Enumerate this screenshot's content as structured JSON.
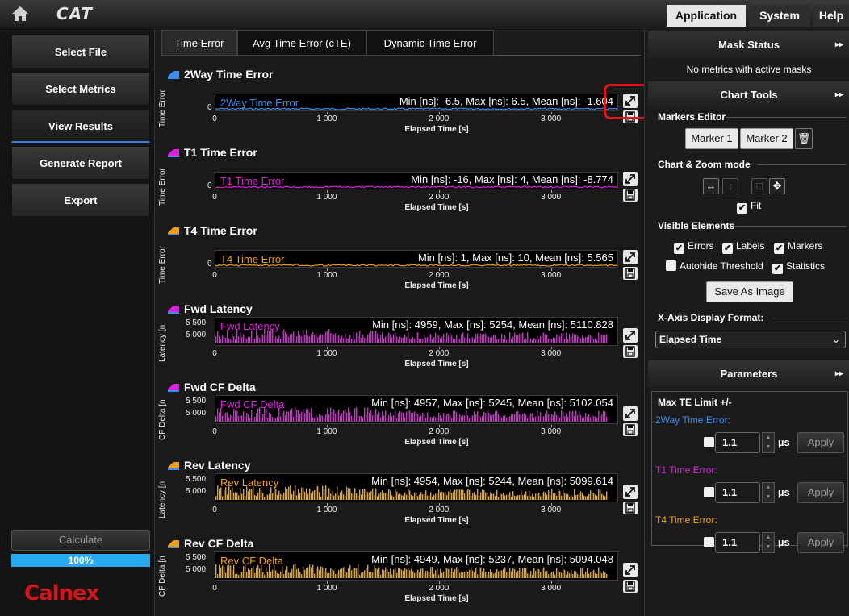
{
  "topbar": {
    "logo": "CAT",
    "menu": [
      "Application",
      "System",
      "Help"
    ]
  },
  "nav": {
    "items": [
      "Select File",
      "Select Metrics",
      "View Results",
      "Generate Report",
      "Export"
    ],
    "active": "View Results",
    "calculate_label": "Calculate",
    "progress_label": "100%",
    "progress_value": 1.0,
    "brand": "Calnex"
  },
  "tabs": [
    "Time Error",
    "Avg Time Error (cTE)",
    "Dynamic Time Error"
  ],
  "charts": [
    {
      "title": "2Way Time Error",
      "color": "#3a8ef0",
      "ylabel": "Time Error [r",
      "yticks": [
        "0"
      ],
      "trace": "2Way Time Error",
      "stats_prefix": "Min [ns]: -6.5, Max [ns]: 6.5, Mean [ns]: -1.604",
      "style": "flat"
    },
    {
      "title": "T1 Time Error",
      "color": "#e020e0",
      "ylabel": "Time Error [r",
      "yticks": [
        "0"
      ],
      "trace": "T1 Time Error",
      "stats_prefix": "Min [ns]: -16, Max [ns]: 4, Mean [ns]: -8.774",
      "style": "flat"
    },
    {
      "title": "T4 Time Error",
      "color": "#f0a010",
      "ylabel": "Time Error [r",
      "yticks": [
        "0"
      ],
      "trace": "T4 Time Error",
      "stats_prefix": "Min [ns]: 1, Max [ns]: 10, Mean [ns]: 5.565",
      "style": "flat"
    },
    {
      "title": "Fwd Latency",
      "color": "#e020e0",
      "ylabel": "Latency [n",
      "yticks": [
        "5 500",
        "5 000"
      ],
      "trace": "Fwd Latency",
      "stats_prefix": "Min [ns]: 4959, Max [ns]: 5254, Mean [ns]: 5110.828",
      "style": "dense"
    },
    {
      "title": "Fwd CF Delta",
      "color": "#e020e0",
      "ylabel": "CF Delta [n",
      "yticks": [
        "5 500",
        "5 000"
      ],
      "trace": "Fwd CF Delta",
      "stats_prefix": "Min [ns]: 4957, Max [ns]: 5245, Mean [ns]: 5102.054",
      "style": "dense"
    },
    {
      "title": "Rev Latency",
      "color": "#f0a010",
      "ylabel": "Latency [n",
      "yticks": [
        "5 500",
        "5 000"
      ],
      "trace": "Rev Latency",
      "stats_prefix": "Min [ns]: 4954, Max [ns]: 5244, Mean [ns]: 5099.614",
      "style": "dense"
    },
    {
      "title": "Rev CF Delta",
      "color": "#f0a010",
      "ylabel": "CF Delta [n",
      "yticks": [
        "5 500",
        "5 000"
      ],
      "trace": "Rev CF Delta",
      "stats_prefix": "Min [ns]: 4949, Max [ns]: 5237, Mean [ns]: 5094.048",
      "style": "dense"
    }
  ],
  "xaxis": {
    "ticks": [
      "0",
      "1 000",
      "2 000",
      "3 000"
    ],
    "tick_values": [
      0,
      1000,
      2000,
      3000
    ],
    "max": 3600,
    "label": "Elapsed Time [s]"
  },
  "right": {
    "mask_status_title": "Mask Status",
    "mask_status_text": "No metrics with active masks",
    "chart_tools_title": "Chart Tools",
    "markers_editor": "Markers Editor",
    "marker1": "Marker 1",
    "marker2": "Marker 2",
    "chart_zoom": "Chart & Zoom mode",
    "fit": "Fit",
    "visible_elements": "Visible Elements",
    "errors": "Errors",
    "labels": "Labels",
    "markers": "Markers",
    "autohide": "Autohide Threshold",
    "statistics": "Statistics",
    "save_image": "Save As Image",
    "xaxis_format_label": "X-Axis Display Format:",
    "xaxis_format_value": "Elapsed Time",
    "parameters_title": "Parameters",
    "max_te": "Max TE Limit +/-",
    "params": [
      {
        "label": "2Way Time Error:",
        "color": "#3a8ef0",
        "value": "1.1",
        "unit": "µs",
        "apply": "Apply"
      },
      {
        "label": "T1 Time Error:",
        "color": "#e020e0",
        "value": "1.1",
        "unit": "µs",
        "apply": "Apply"
      },
      {
        "label": "T4 Time Error:",
        "color": "#f0a010",
        "value": "1.1",
        "unit": "µs",
        "apply": "Apply"
      }
    ]
  }
}
